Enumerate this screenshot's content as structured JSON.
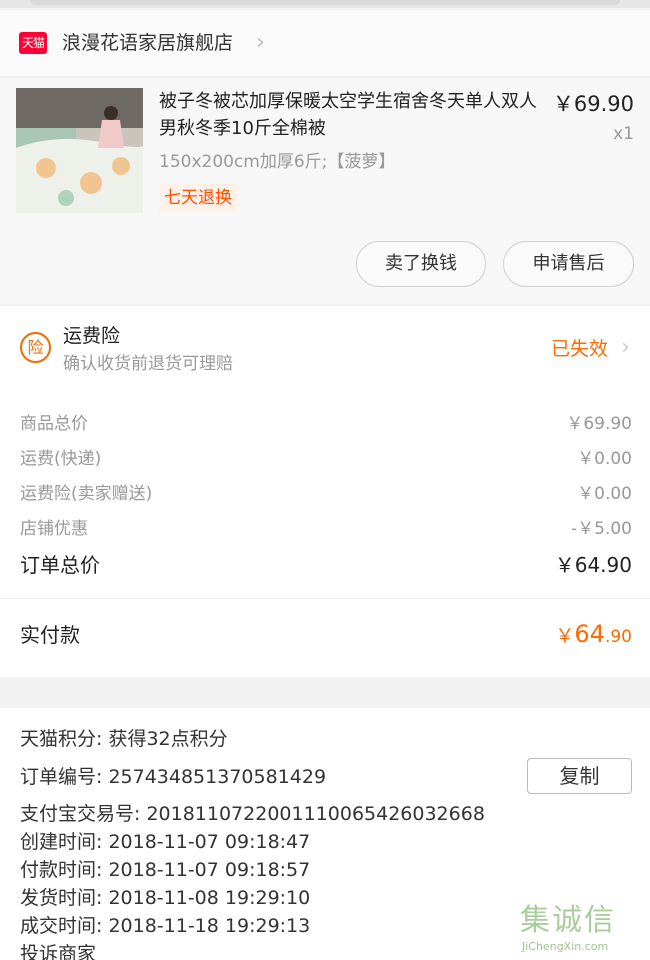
{
  "store": {
    "logo_text": "天猫",
    "name": "浪漫花语家居旗舰店"
  },
  "product": {
    "title": "被子冬被芯加厚保暖太空学生宿舍冬天单人双人男秋冬季10斤全棉被",
    "sku": "150x200cm加厚6斤;【菠萝】",
    "badge": "七天退换",
    "price": "￥69.90",
    "qty": "x1",
    "sell_label": "卖了换钱",
    "after_sale_label": "申请售后"
  },
  "insurance": {
    "icon_text": "险",
    "title": "运费险",
    "subtitle": "确认收货前退货可理赔",
    "status": "已失效"
  },
  "costs": [
    {
      "label": "商品总价",
      "value": "￥69.90"
    },
    {
      "label": "运费(快递)",
      "value": "￥0.00"
    },
    {
      "label": "运费险(卖家赠送)",
      "value": "￥0.00"
    },
    {
      "label": "店铺优惠",
      "value": "-￥5.00"
    }
  ],
  "order_total": {
    "label": "订单总价",
    "value": "￥64.90"
  },
  "paid": {
    "label": "实付款",
    "currency": "￥",
    "int": "64",
    "dec": ".90"
  },
  "info": {
    "points": "天猫积分:  获得32点积分",
    "order_no": "订单编号:  257434851370581429",
    "alipay_no": "支付宝交易号:  2018110722001110065426032668",
    "created": "创建时间:  2018-11-07 09:18:47",
    "paid_time": "付款时间:  2018-11-07 09:18:57",
    "shipped": "发货时间:  2018-11-08 19:29:10",
    "completed": "成交时间:  2018-11-18 19:29:13",
    "complaint": "投诉商家",
    "copy_label": "复制"
  },
  "watermark": {
    "cn": "集诚信",
    "en": "JiChengXin.com"
  },
  "colors": {
    "accent": "#ff6a00",
    "tmall": "#ff0036"
  }
}
